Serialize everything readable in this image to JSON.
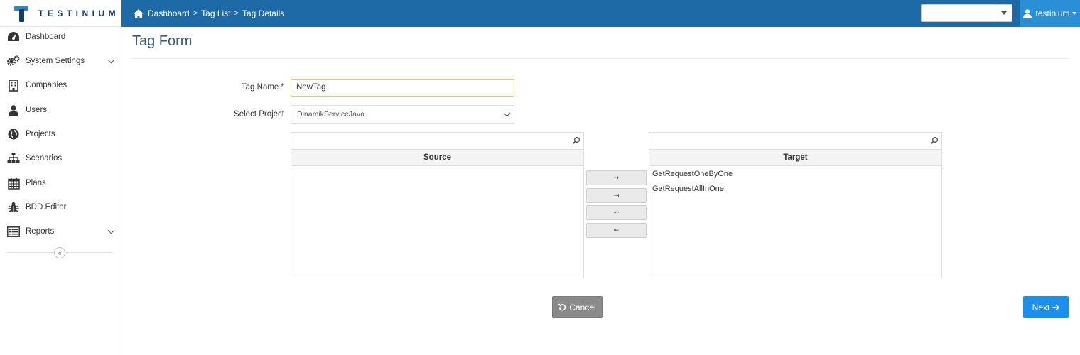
{
  "app": {
    "logo_text": "TESTINIUM"
  },
  "breadcrumb": {
    "items": [
      "Dashboard",
      "Tag List",
      "Tag Details"
    ]
  },
  "header": {
    "project_select_value": "",
    "user_name": "testinium"
  },
  "sidebar": {
    "items": [
      {
        "label": "Dashboard",
        "icon": "dashboard-icon"
      },
      {
        "label": "System Settings",
        "icon": "gears-icon",
        "expandable": true
      },
      {
        "label": "Companies",
        "icon": "building-icon"
      },
      {
        "label": "Users",
        "icon": "user-icon"
      },
      {
        "label": "Projects",
        "icon": "globe-icon"
      },
      {
        "label": "Scenarios",
        "icon": "sitemap-icon"
      },
      {
        "label": "Plans",
        "icon": "calendar-icon"
      },
      {
        "label": "BDD Editor",
        "icon": "bug-icon"
      },
      {
        "label": "Reports",
        "icon": "list-alt-icon",
        "expandable": true
      }
    ],
    "collapse_label": "«"
  },
  "page": {
    "title": "Tag Form"
  },
  "form": {
    "tag_name_label": "Tag Name *",
    "tag_name_value": "NewTag",
    "project_label": "Select Project",
    "project_value": "DinamikServiceJava"
  },
  "picklist": {
    "source_title": "Source",
    "target_title": "Target",
    "source_items": [],
    "target_items": [
      "GetRequestOneByOne",
      "GetRequestAllInOne"
    ],
    "buttons": [
      "⇢",
      "⇥",
      "⇠",
      "⇤"
    ]
  },
  "actions": {
    "cancel_label": "Cancel",
    "next_label": "Next"
  },
  "colors": {
    "topbar": "#1e6aa6",
    "accent": "#2b8fd8",
    "next": "#1b8ff0",
    "cancel": "#8a8a8a"
  }
}
